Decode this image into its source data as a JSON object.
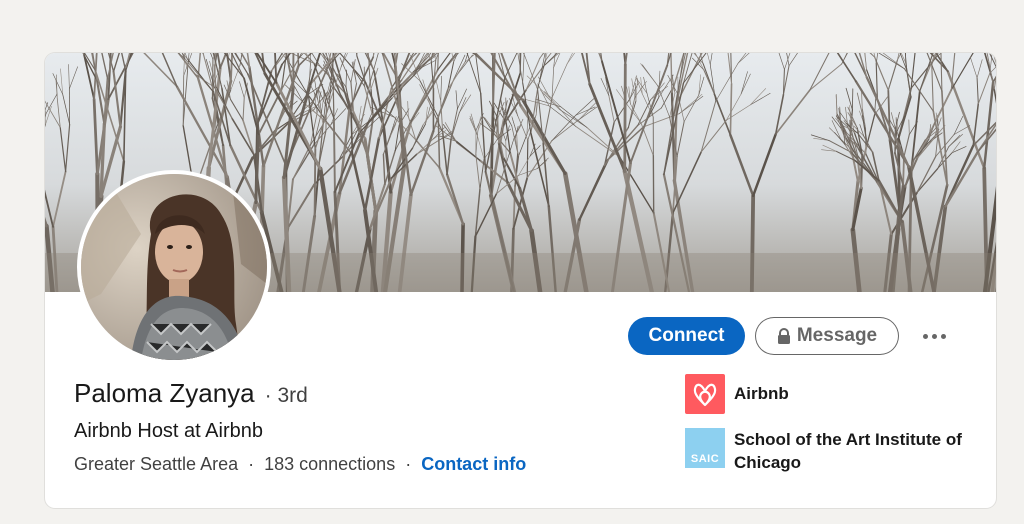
{
  "profile": {
    "name": "Paloma Zyanya",
    "degree": "· 3rd",
    "headline": "Airbnb Host at Airbnb",
    "location": "Greater Seattle Area",
    "separator": "·",
    "connections": "183 connections",
    "contact_info": "Contact info"
  },
  "actions": {
    "connect_label": "Connect",
    "message_label": "Message",
    "more_icon": "ellipsis-icon"
  },
  "experience": [
    {
      "name": "Airbnb",
      "logo": "airbnb-logo",
      "color": "#ff5a5f"
    },
    {
      "name": "School of the Art Institute of Chicago",
      "logo_text": "SAIC",
      "color": "#8dd0f0"
    }
  ],
  "colors": {
    "accent": "#0a66c2",
    "page_background": "#f3f2ef",
    "card_background": "#ffffff"
  }
}
